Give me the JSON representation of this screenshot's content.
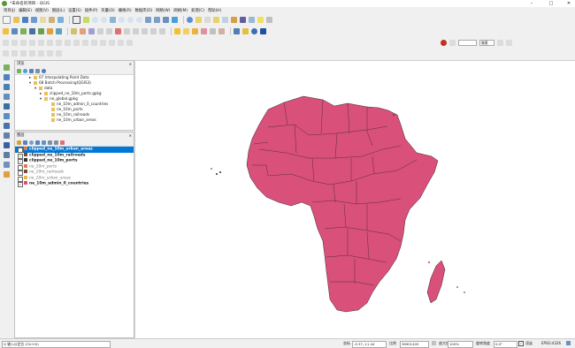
{
  "window": {
    "title": "*未命名的项目 - QGIS",
    "controls": {
      "minimize": "–",
      "maximize": "□",
      "close": "✕"
    }
  },
  "menu": [
    "项目(J)",
    "编辑(E)",
    "视图(V)",
    "图层(L)",
    "设置(S)",
    "插件(P)",
    "矢量(O)",
    "栅格(R)",
    "数据库(D)",
    "网络(W)",
    "网格(M)",
    "处理(C)",
    "帮助(H)"
  ],
  "browser_panel": {
    "title": "浏览",
    "close": "✕",
    "tree": [
      {
        "indent": 16,
        "arrow": "▸",
        "label": "07 Interpolating Point Data"
      },
      {
        "indent": 16,
        "arrow": "▾",
        "label": "08 Batch-Processing(QGIS3)"
      },
      {
        "indent": 22,
        "arrow": "▾",
        "label": "data"
      },
      {
        "indent": 28,
        "arrow": "▸",
        "label": "clipped_ne_10m_ports.gpkg"
      },
      {
        "indent": 28,
        "arrow": "▾",
        "label": "ne_global.gpkg"
      },
      {
        "indent": 36,
        "arrow": "",
        "label": "ne_10m_admin_0_countries"
      },
      {
        "indent": 36,
        "arrow": "",
        "label": "ne_10m_ports"
      },
      {
        "indent": 36,
        "arrow": "",
        "label": "ne_10m_railroads"
      },
      {
        "indent": 36,
        "arrow": "",
        "label": "ne_10m_urban_areas"
      }
    ]
  },
  "layers_panel": {
    "title": "图层",
    "close": "✕",
    "layers": [
      {
        "name": "clipped_ne_10m_urban_areas",
        "checked": true,
        "style": "sel",
        "swatch": "#e07a4b"
      },
      {
        "name": "clipped_ne_10m_railroads",
        "checked": true,
        "style": "b",
        "swatch": "#7a4b2e"
      },
      {
        "name": "clipped_ne_10m_ports",
        "checked": true,
        "style": "b",
        "swatch": "#333333"
      },
      {
        "name": "ne_10m_ports",
        "checked": false,
        "style": "i",
        "swatch": "#e07a4b"
      },
      {
        "name": "ne_10m_railroads",
        "checked": false,
        "style": "i",
        "swatch": "#7a4b2e"
      },
      {
        "name": "ne_10m_urban_areas",
        "checked": false,
        "style": "i",
        "swatch": "#e6b84c"
      },
      {
        "name": "ne_10m_admin_0_countries",
        "checked": true,
        "style": "b",
        "swatch": "#d9507a"
      }
    ]
  },
  "map": {
    "fill_color": "#d9507a",
    "stroke_color": "#3a2530"
  },
  "statusbar": {
    "search_placeholder": "Q 输入以定位 (Ctrl+K)",
    "coord_label": "坐标",
    "coord_value": "-9.37,-11.44",
    "scale_label": "比例",
    "scale_value": "36901405",
    "magnifier_label": "放大镜",
    "magnifier_value": "100%",
    "rotation_label": "旋转角度",
    "rotation_value": "0.0°",
    "render_label": "渲染",
    "crs": "EPSG:4326"
  },
  "toolbar": {
    "zoom_label": "像素"
  }
}
